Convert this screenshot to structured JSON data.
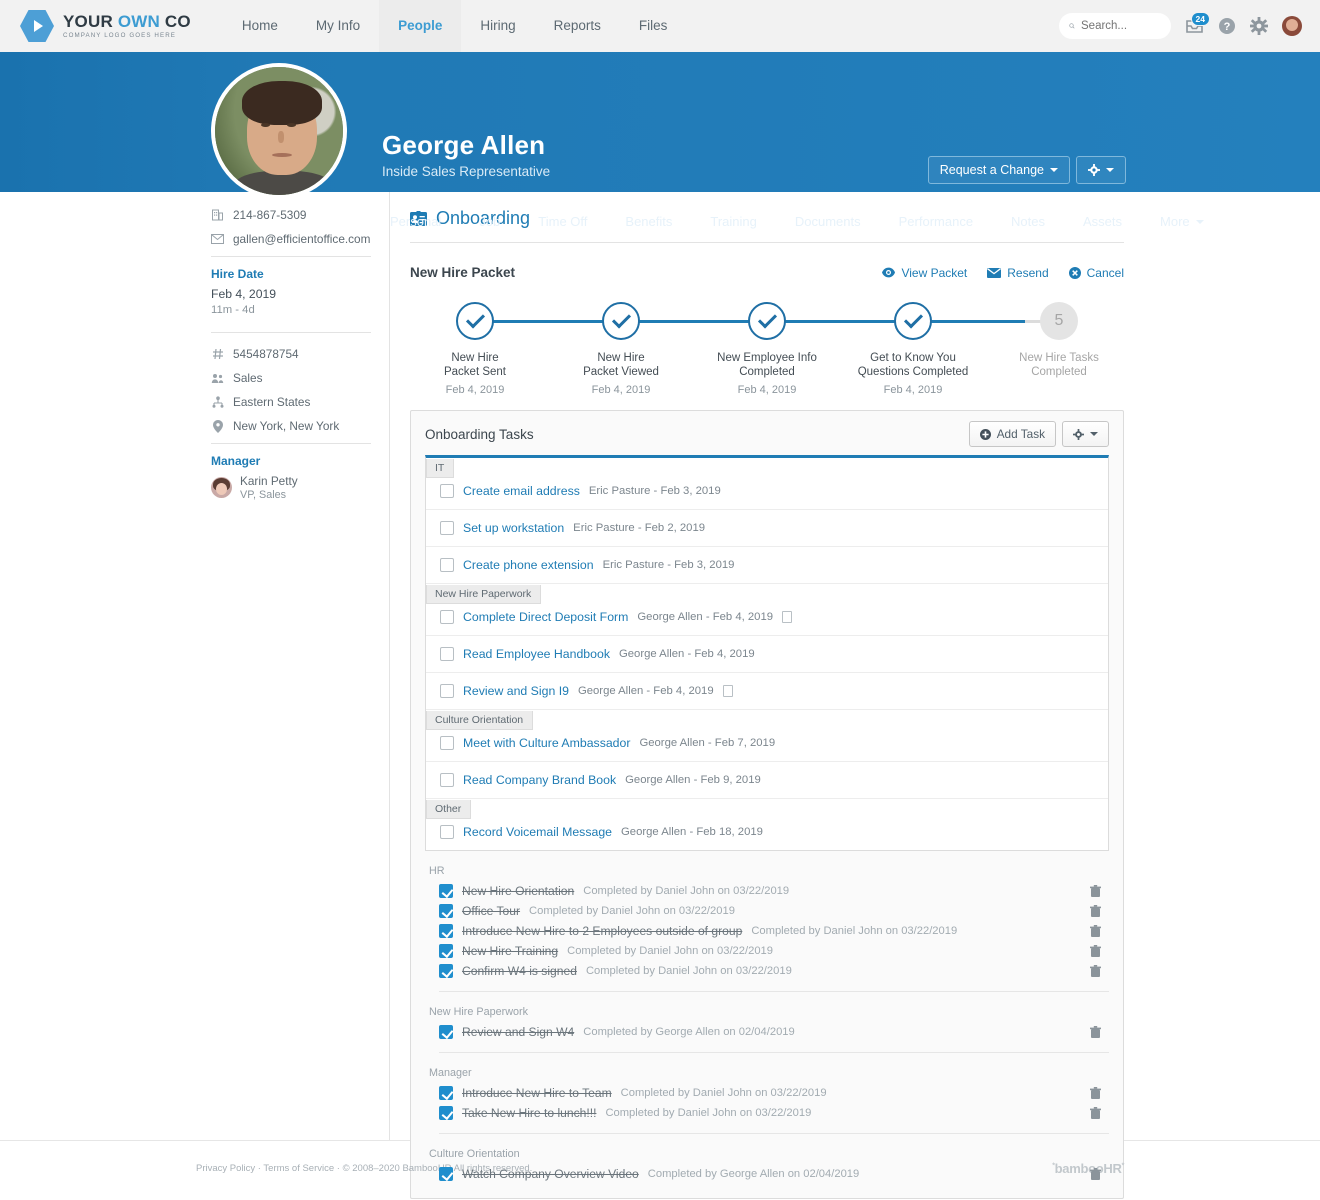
{
  "topnav": {
    "logo": {
      "main_1": "YOUR ",
      "main_2": "OWN",
      "main_3": " CO",
      "sub": "COMPANY LOGO GOES HERE"
    },
    "links": [
      {
        "label": "Home",
        "active": false
      },
      {
        "label": "My Info",
        "active": false
      },
      {
        "label": "People",
        "active": true
      },
      {
        "label": "Hiring",
        "active": false
      },
      {
        "label": "Reports",
        "active": false
      },
      {
        "label": "Files",
        "active": false
      }
    ],
    "search_placeholder": "Search...",
    "inbox_badge": "24"
  },
  "profile": {
    "name": "George Allen",
    "job_title": "Inside Sales Representative",
    "request_change_label": "Request a Change",
    "tabs": [
      {
        "label": "Personal"
      },
      {
        "label": "Job"
      },
      {
        "label": "Time Off"
      },
      {
        "label": "Benefits"
      },
      {
        "label": "Training"
      },
      {
        "label": "Documents"
      },
      {
        "label": "Performance"
      },
      {
        "label": "Notes"
      },
      {
        "label": "Assets"
      },
      {
        "label": "More"
      }
    ]
  },
  "sidebar": {
    "phone": "214-867-5309",
    "email": "gallen@efficientoffice.com",
    "hire_date_label": "Hire Date",
    "hire_date": "Feb 4, 2019",
    "tenure": "11m - 4d",
    "employee_id": "5454878754",
    "department": "Sales",
    "division": "Eastern States",
    "location": "New York, New York",
    "manager_label": "Manager",
    "manager_name": "Karin Petty",
    "manager_title": "VP, Sales"
  },
  "onboarding": {
    "title": "Onboarding",
    "packet_title": "New Hire Packet",
    "actions": [
      {
        "label": "View Packet",
        "icon": "eye-icon"
      },
      {
        "label": "Resend",
        "icon": "envelope-icon"
      },
      {
        "label": "Cancel",
        "icon": "cancel-icon"
      }
    ],
    "steps": [
      {
        "label_1": "New Hire",
        "label_2": "Packet Sent",
        "date": "Feb 4, 2019",
        "done": true
      },
      {
        "label_1": "New Hire",
        "label_2": "Packet Viewed",
        "date": "Feb 4, 2019",
        "done": true
      },
      {
        "label_1": "New Employee Info",
        "label_2": "Completed",
        "date": "Feb 4, 2019",
        "done": true
      },
      {
        "label_1": "Get to Know You",
        "label_2": "Questions Completed",
        "date": "Feb 4, 2019",
        "done": true
      },
      {
        "label_1": "New Hire Tasks",
        "label_2": "Completed",
        "date": "",
        "done": false,
        "number": "5"
      }
    ]
  },
  "tasks": {
    "header": "Onboarding Tasks",
    "add_task_label": "Add Task",
    "open_groups": [
      {
        "name": "IT",
        "items": [
          {
            "name": "Create email address",
            "meta": "Eric Pasture - Feb 3, 2019",
            "doc": false
          },
          {
            "name": "Set up workstation",
            "meta": "Eric Pasture - Feb 2, 2019",
            "doc": false
          },
          {
            "name": "Create phone extension",
            "meta": "Eric Pasture - Feb 3, 2019",
            "doc": false
          }
        ]
      },
      {
        "name": "New Hire Paperwork",
        "items": [
          {
            "name": "Complete Direct Deposit Form",
            "meta": "George Allen - Feb 4, 2019",
            "doc": true
          },
          {
            "name": "Read Employee Handbook",
            "meta": "George Allen - Feb 4, 2019",
            "doc": false
          },
          {
            "name": "Review and Sign I9",
            "meta": "George Allen - Feb 4, 2019",
            "doc": true
          }
        ]
      },
      {
        "name": "Culture Orientation",
        "items": [
          {
            "name": "Meet with Culture Ambassador",
            "meta": "George Allen - Feb 7, 2019",
            "doc": false
          },
          {
            "name": "Read Company Brand Book",
            "meta": "George Allen - Feb 9, 2019",
            "doc": false
          }
        ]
      },
      {
        "name": "Other",
        "items": [
          {
            "name": "Record Voicemail Message",
            "meta": "George Allen - Feb 18, 2019",
            "doc": false
          }
        ]
      }
    ],
    "completed_groups": [
      {
        "name": "HR",
        "items": [
          {
            "name": "New Hire Orientation",
            "meta": "Completed by Daniel John on 03/22/2019"
          },
          {
            "name": "Office Tour",
            "meta": "Completed by Daniel John on 03/22/2019"
          },
          {
            "name": "Introduce New Hire to 2 Employees outside of group",
            "meta": "Completed by Daniel John on 03/22/2019"
          },
          {
            "name": "New Hire Training",
            "meta": "Completed by Daniel John on 03/22/2019"
          },
          {
            "name": "Confirm W4 is signed",
            "meta": "Completed by Daniel John on 03/22/2019"
          }
        ]
      },
      {
        "name": "New Hire Paperwork",
        "items": [
          {
            "name": "Review and Sign W4",
            "meta": "Completed by George Allen on 02/04/2019"
          }
        ]
      },
      {
        "name": "Manager",
        "items": [
          {
            "name": "Introduce New Hire to Team",
            "meta": "Completed by Daniel John on 03/22/2019"
          },
          {
            "name": "Take New Hire to lunch!!!",
            "meta": "Completed by Daniel John on 03/22/2019"
          }
        ]
      },
      {
        "name": "Culture Orientation",
        "items": [
          {
            "name": "Watch Company Overview Video",
            "meta": "Completed by George Allen on 02/04/2019"
          }
        ]
      }
    ]
  },
  "footer": {
    "privacy": "Privacy Policy",
    "sep1": "·",
    "terms": "Terms of Service",
    "sep2": "·",
    "copyright": "© 2008–2020 BambooHR All rights reserved.",
    "logo": "bambooHR"
  },
  "colors": {
    "brand_blue": "#1f7cb4",
    "header_blue": "#2079b5",
    "link_blue": "#1f7cb4",
    "accent": "#3d9cd2"
  }
}
